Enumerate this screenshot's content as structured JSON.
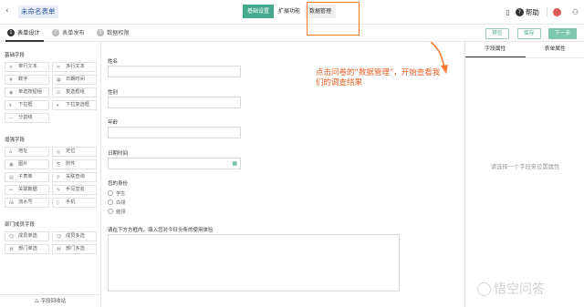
{
  "header": {
    "back": "‹",
    "title": "未命名表单",
    "tabs": [
      {
        "label": "基础设置",
        "active": true
      },
      {
        "label": "扩展功能",
        "active": false
      },
      {
        "label": "数据管理",
        "active": false
      }
    ],
    "help_label": "帮助",
    "icons": [
      "phone-icon",
      "help-icon",
      "bell-icon",
      "avatar-icon"
    ]
  },
  "steps": [
    {
      "num": "1",
      "label": "表单设计",
      "active": true
    },
    {
      "num": "2",
      "label": "表单发布",
      "active": false
    },
    {
      "num": "3",
      "label": "数据权限",
      "active": false
    }
  ],
  "actions": {
    "preview": "预览",
    "save": "保存",
    "next": "下一步"
  },
  "sidebar": {
    "groups": [
      {
        "title": "基础字段",
        "items": [
          "单行文本",
          "多行文本",
          "数字",
          "日期时间",
          "单选按钮组",
          "复选框组",
          "下拉框",
          "下拉复选框",
          "分割线"
        ]
      },
      {
        "title": "增强字段",
        "items": [
          "地址",
          "定位",
          "图片",
          "附件",
          "子表单",
          "关联查询",
          "关联数据",
          "手写签名",
          "流水号",
          "手机"
        ]
      },
      {
        "title": "部门成员字段",
        "items": [
          "成员单选",
          "成员多选",
          "部门单选",
          "部门多选"
        ]
      }
    ],
    "recycle": "字段回收站"
  },
  "form": {
    "fields": [
      {
        "label": "姓名"
      },
      {
        "label": "性别"
      },
      {
        "label": "年龄"
      },
      {
        "label": "日期时间"
      }
    ],
    "identity": {
      "label": "您的身份",
      "options": [
        "学生",
        "白领",
        "蓝领"
      ]
    },
    "textarea_label": "请在下方方框内，填入您对今日头条的使用体验",
    "annotation": "点击问卷的“数据管理”，开始查看我们的调查结果",
    "annotation_color": "#e85d22"
  },
  "right_panel": {
    "tabs": [
      "字段属性",
      "表单属性"
    ],
    "hint": "请选择一个字段来设置属性"
  },
  "watermark": "悟空问答",
  "colors": {
    "accent": "#44aa8e",
    "annotation": "#ff7a2f"
  }
}
